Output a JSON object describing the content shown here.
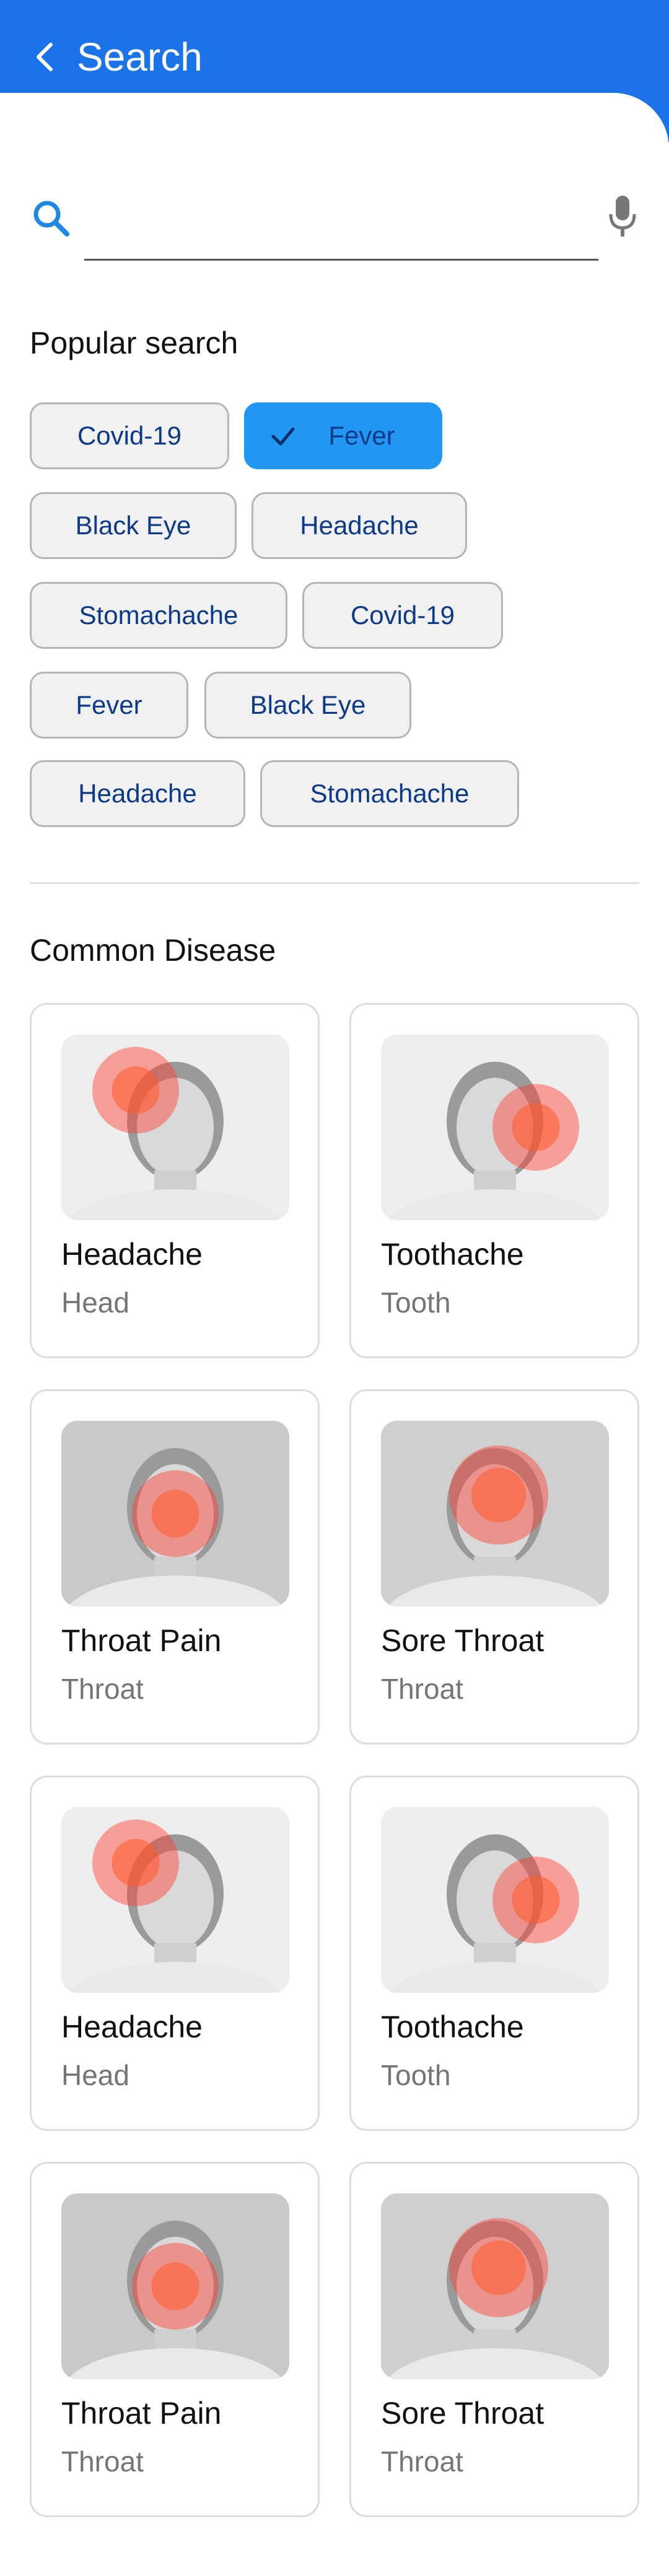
{
  "header": {
    "title": "Search",
    "back_icon": "chevron-left-icon",
    "bg_color": "#1a73e8"
  },
  "search": {
    "value": "",
    "placeholder": "",
    "search_icon": "search-icon",
    "mic_icon": "mic-icon"
  },
  "popular": {
    "title": "Popular search",
    "chips": [
      {
        "label": "Covid-19",
        "selected": false
      },
      {
        "label": "Fever",
        "selected": true
      },
      {
        "label": "Black Eye",
        "selected": false
      },
      {
        "label": "Headache",
        "selected": false
      },
      {
        "label": "Stomachache",
        "selected": false
      },
      {
        "label": "Covid-19",
        "selected": false
      },
      {
        "label": "Fever",
        "selected": false
      },
      {
        "label": "Black Eye",
        "selected": false
      },
      {
        "label": "Headache",
        "selected": false
      },
      {
        "label": "Stomachache",
        "selected": false
      }
    ]
  },
  "common": {
    "title": "Common Disease",
    "cards": [
      {
        "name": "Headache",
        "sub": "Head"
      },
      {
        "name": "Toothache",
        "sub": "Tooth"
      },
      {
        "name": "Throat Pain",
        "sub": "Throat"
      },
      {
        "name": "Sore Throat",
        "sub": "Throat"
      },
      {
        "name": "Headache",
        "sub": "Head"
      },
      {
        "name": "Toothache",
        "sub": "Tooth"
      },
      {
        "name": "Throat Pain",
        "sub": "Throat"
      },
      {
        "name": "Sore Throat",
        "sub": "Throat"
      }
    ]
  }
}
